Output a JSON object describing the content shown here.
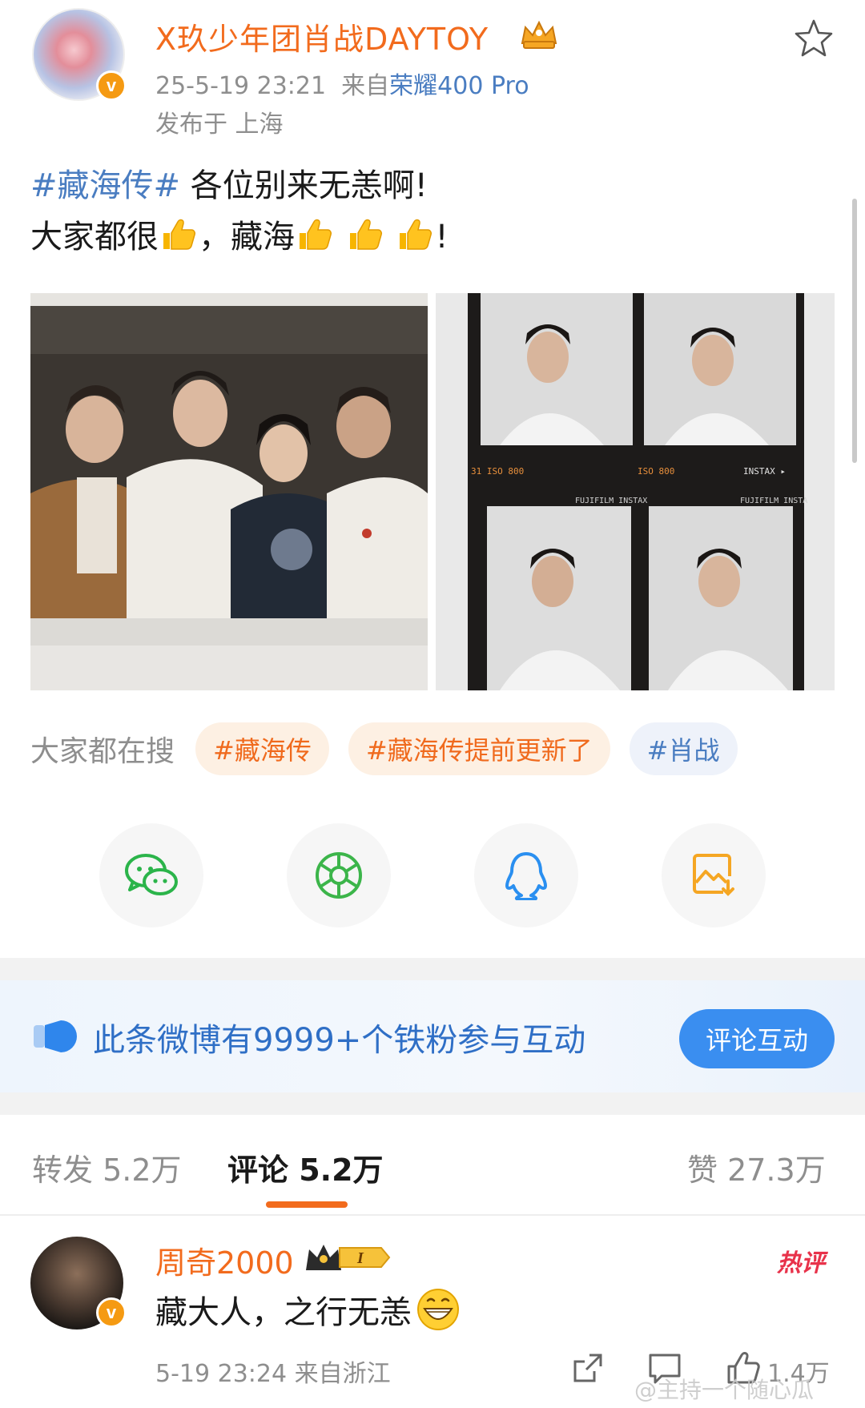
{
  "post": {
    "author": "X玖少年团肖战DAYTOY",
    "timestamp": "25-5-19 23:21",
    "source_prefix": "来自",
    "device": "荣耀400 Pro",
    "location": "发布于 上海",
    "hashtag": "#藏海传#",
    "line1_rest": " 各位别来无恙啊!",
    "line2_a": "大家都很",
    "line2_b": "，藏海",
    "line2_end": "!"
  },
  "images": [
    {
      "label": "group-photo"
    },
    {
      "label": "instax-film-strip",
      "film_text_1": "31 ISO 800",
      "film_text_2": "ISO 800",
      "film_text_3": "INSTAX ▸",
      "film_text_4": "FUJIFILM INSTAX",
      "film_text_5": "FUJIFILM INSTA"
    }
  ],
  "hot_search": {
    "label": "大家都在搜",
    "chips": [
      "#藏海传",
      "#藏海传提前更新了",
      "#肖战"
    ]
  },
  "share": {
    "icons": [
      "wechat-icon",
      "moments-icon",
      "qq-icon",
      "save-image-icon"
    ]
  },
  "fan_banner": {
    "text": "此条微博有9999+个铁粉参与互动",
    "button": "评论互动"
  },
  "tabs": {
    "repost": "转发 5.2万",
    "comments": "评论 5.2万",
    "likes": "赞 27.3万"
  },
  "comment": {
    "author": "周奇2000",
    "hot_label": "热评",
    "text": "藏大人，之行无恙",
    "meta": "5-19 23:24 来自浙江",
    "like_count": "1.4万",
    "badge_level": "I"
  },
  "watermark": "@主持一个随心瓜",
  "colors": {
    "accent_orange": "#f26b1d",
    "link_blue": "#4a7dc1",
    "button_blue": "#3a8ef0",
    "hot_red": "#e8324a"
  }
}
